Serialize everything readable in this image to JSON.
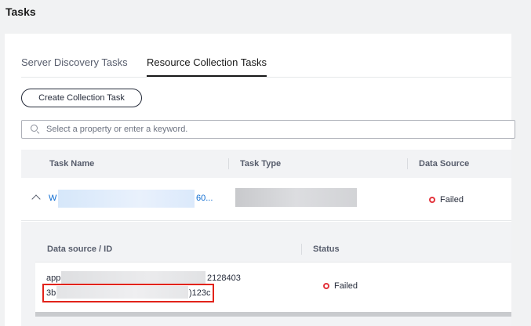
{
  "page": {
    "title": "Tasks"
  },
  "tabs": [
    {
      "label": "Server Discovery Tasks",
      "active": false
    },
    {
      "label": "Resource Collection Tasks",
      "active": true
    }
  ],
  "toolbar": {
    "create_label": "Create Collection Task"
  },
  "search": {
    "placeholder": "Select a property or enter a keyword."
  },
  "table": {
    "columns": [
      "Task Name",
      "Task Type",
      "Data Source"
    ],
    "rows": [
      {
        "name_prefix": "W",
        "name_suffix": "60...",
        "data_source_status": "Failed",
        "expanded": true,
        "details": {
          "columns": [
            "Data source / ID",
            "Status"
          ],
          "rows": [
            {
              "source_prefix": "app",
              "source_suffix": "2128403",
              "id_prefix": "3b(",
              "id_suffix": ")123c",
              "status": "Failed"
            }
          ]
        }
      }
    ]
  },
  "colors": {
    "link": "#0a6ad1",
    "failed": "#e3343c",
    "highlight": "#e2231a"
  },
  "icons": [
    "search-icon",
    "chevron-up-icon",
    "status-failed-icon"
  ]
}
